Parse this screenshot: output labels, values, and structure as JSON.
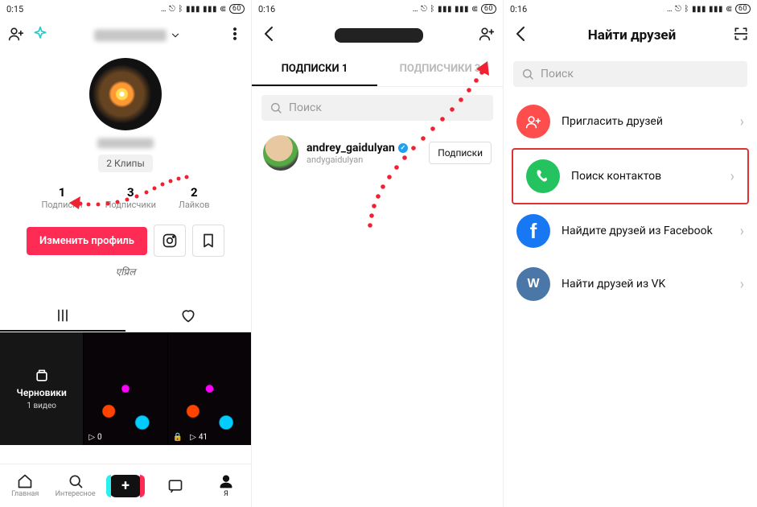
{
  "panel1": {
    "status": {
      "time": "0:15",
      "battery": "60"
    },
    "chip": "2 Клипы",
    "stats": [
      {
        "n": "1",
        "l": "Подписки"
      },
      {
        "n": "3",
        "l": "Подписчики"
      },
      {
        "n": "2",
        "l": "Лайков"
      }
    ],
    "edit_btn": "Изменить профиль",
    "bio": "एप्रिल",
    "tiles": {
      "drafts_title": "Черновики",
      "drafts_sub": "1 видео",
      "v2_count": "0",
      "v3_count": "41"
    },
    "bottomnav": {
      "home": "Главная",
      "discover": "Интересное",
      "inbox": "",
      "me": "Я"
    }
  },
  "panel2": {
    "status": {
      "time": "0:16",
      "battery": "60"
    },
    "tabs": {
      "following": "ПОДПИСКИ 1",
      "followers": "ПОДПИСЧИКИ 3"
    },
    "search_placeholder": "Поиск",
    "user": {
      "name": "andrey_gaidulyan",
      "sub": "andygaidulyan",
      "button": "Подписки"
    }
  },
  "panel3": {
    "status": {
      "time": "0:16",
      "battery": "60"
    },
    "title": "Найти друзей",
    "search_placeholder": "Поиск",
    "rows": {
      "invite": "Пригласить друзей",
      "contacts": "Поиск контактов",
      "facebook": "Найдите друзей из Facebook",
      "vk": "Найти друзей из VK"
    }
  }
}
